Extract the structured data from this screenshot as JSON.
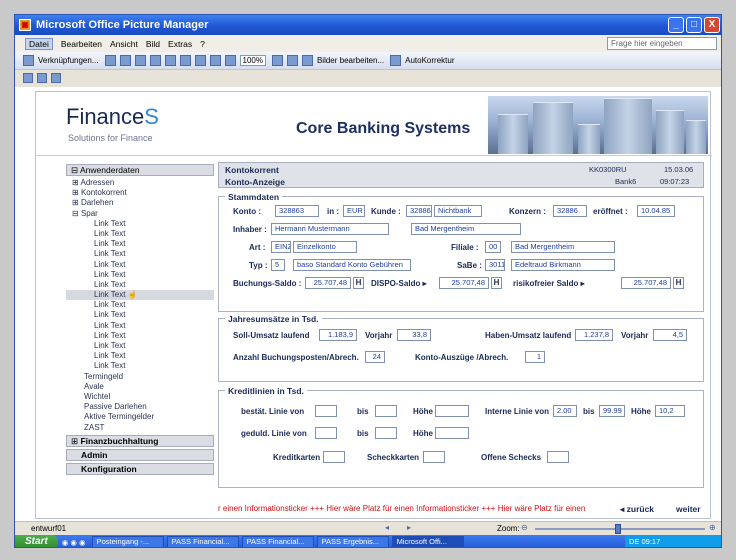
{
  "window": {
    "title": "Microsoft Office Picture Manager",
    "min": "_",
    "max": "□",
    "close": "X"
  },
  "menu": {
    "items": [
      "Datei",
      "Bearbeiten",
      "Ansicht",
      "Bild",
      "Extras",
      "?"
    ],
    "help_placeholder": "Frage hier eingeben"
  },
  "toolbar": {
    "shortcuts": "Verknüpfungen...",
    "zoom": "100%",
    "edit_pictures": "Bilder bearbeiten...",
    "autocorrect": "AutoKorrektur"
  },
  "app": {
    "logo_main": "Finance",
    "logo_s": "S",
    "tagline": "Solutions for Finance",
    "title": "Core Banking Systems"
  },
  "sidebar": {
    "anwenderdaten": "Anwenderdaten",
    "items": [
      "Adressen",
      "Kontokorrent",
      "Darlehen",
      "Spar",
      "Link Text",
      "Link Text",
      "Link Text",
      "Link Text",
      "Link Text",
      "Link Text",
      "Link Text",
      "Link Text",
      "Link Text",
      "Link Text",
      "Link Text",
      "Link Text",
      "Link Text",
      "Link Text",
      "Link Text",
      "Termingeld",
      "Avale",
      "Wichtel",
      "Passive Darlehen",
      "Aktive Termingelder",
      "ZAST"
    ],
    "finanz": "Finanzbuchhaltung",
    "admin": "Admin",
    "konfiguration": "Konfiguration"
  },
  "top": {
    "title1": "Kontokorrent",
    "title2": "Konto-Anzeige",
    "code": "KK0300RU",
    "bank": "Bank6",
    "date": "15.03.06",
    "time": "09:07:23"
  },
  "stammdaten": {
    "title": "Stammdaten",
    "konto_l": "Konto :",
    "konto": "328863",
    "in_l": "in :",
    "in": "EUR",
    "kunde_l": "Kunde :",
    "kunde_nr": "32886",
    "kunde_name": "Nichtbank",
    "konzern_l": "Konzern :",
    "konzern": "32886",
    "eroeffnet_l": "eröffnet :",
    "eroeffnet": "10.04.85",
    "inhaber_l": "Inhaber :",
    "inhaber": "Hermann Mustermann",
    "ort": "Bad Mergentheim",
    "art_l": "Art :",
    "art": "EINZ",
    "art_t": "Einzelkonto",
    "filiale_l": "Filiale :",
    "filiale": "00",
    "filiale_t": "Bad Mergentheim",
    "typ_l": "Typ :",
    "typ": "5",
    "typ_t": "baso Standard Konto Gebühren",
    "sabe_l": "SaBe :",
    "sabe": "3011",
    "sabe_t": "Edeltraud Birkmann",
    "bs_l": "Buchungs-Saldo :",
    "bs": "25.707,48",
    "h": "H",
    "dispo_l": "DISPO-Saldo ▸",
    "dispo": "25.707,48",
    "rf_l": "risikofreier Saldo ▸",
    "rf": "25.707,48"
  },
  "jahres": {
    "title": "Jahresumsätze in Tsd.",
    "soll_l": "Soll-Umsatz laufend",
    "soll": "1.183,9",
    "vorjahr_l": "Vorjahr",
    "vj1": "33,8",
    "haben_l": "Haben-Umsatz laufend",
    "haben": "1.237,8",
    "vj2": "4,5",
    "anz_l": "Anzahl Buchungsposten/Abrech.",
    "anz": "24",
    "ausz_l": "Konto-Auszüge /Abrech.",
    "ausz": "1"
  },
  "kredit": {
    "title": "Kreditlinien in Tsd.",
    "bestaet_l": "bestät. Linie von",
    "bis_l": "bis",
    "hoehe_l": "Höhe",
    "intern_l": "Interne Linie von",
    "intern_von": "2.00",
    "intern_bis": "99.99",
    "intern_hoehe": "10,2",
    "geduld_l": "geduld. Linie von",
    "karten_l": "Kreditkarten",
    "scheck_l": "Scheckkarten",
    "offen_l": "Offene Schecks"
  },
  "ticker": "r einen Informationsticker +++ Hier wäre Platz für einen Informationsticker +++ Hier wäre Platz für einen",
  "nav": {
    "back": "◂ zurück",
    "next": "weiter ▸"
  },
  "status": {
    "file": "entwurf01",
    "zoom": "Zoom:"
  },
  "taskbar": {
    "start": "Start",
    "tasks": [
      "Posteingang -...",
      "PASS Financial...",
      "PASS Financial...",
      "PASS Ergebnis...",
      "Microsoft Offi..."
    ],
    "tray": "DE  09:17"
  }
}
